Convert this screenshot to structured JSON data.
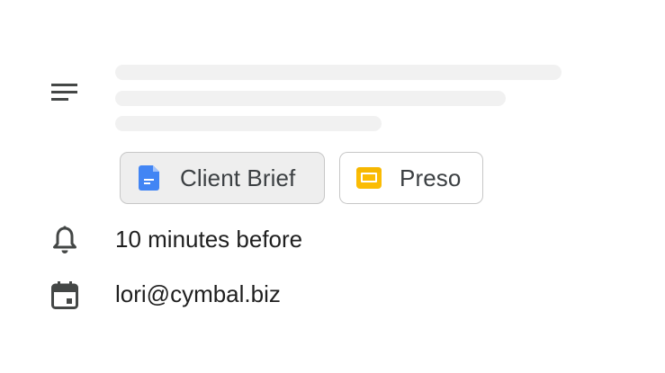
{
  "description_section": {
    "icon": "notes-icon",
    "attachments": [
      {
        "label": "Client Brief",
        "icon": "google-docs-icon",
        "accent": "#4285f4",
        "selected": true
      },
      {
        "label": "Preso",
        "icon": "google-slides-icon",
        "accent": "#fbbc04",
        "selected": false
      }
    ]
  },
  "reminder": {
    "icon": "bell-icon",
    "text": "10 minutes before"
  },
  "calendar": {
    "icon": "calendar-icon",
    "text": "lori@cymbal.biz"
  },
  "colors": {
    "skeleton": "#f1f1f1",
    "chip_border": "#c7c7c7",
    "chip_selected_bg": "#eeeeee",
    "icon_gray": "#444746",
    "docs_blue": "#4285f4",
    "slides_yellow": "#fbbc04"
  }
}
